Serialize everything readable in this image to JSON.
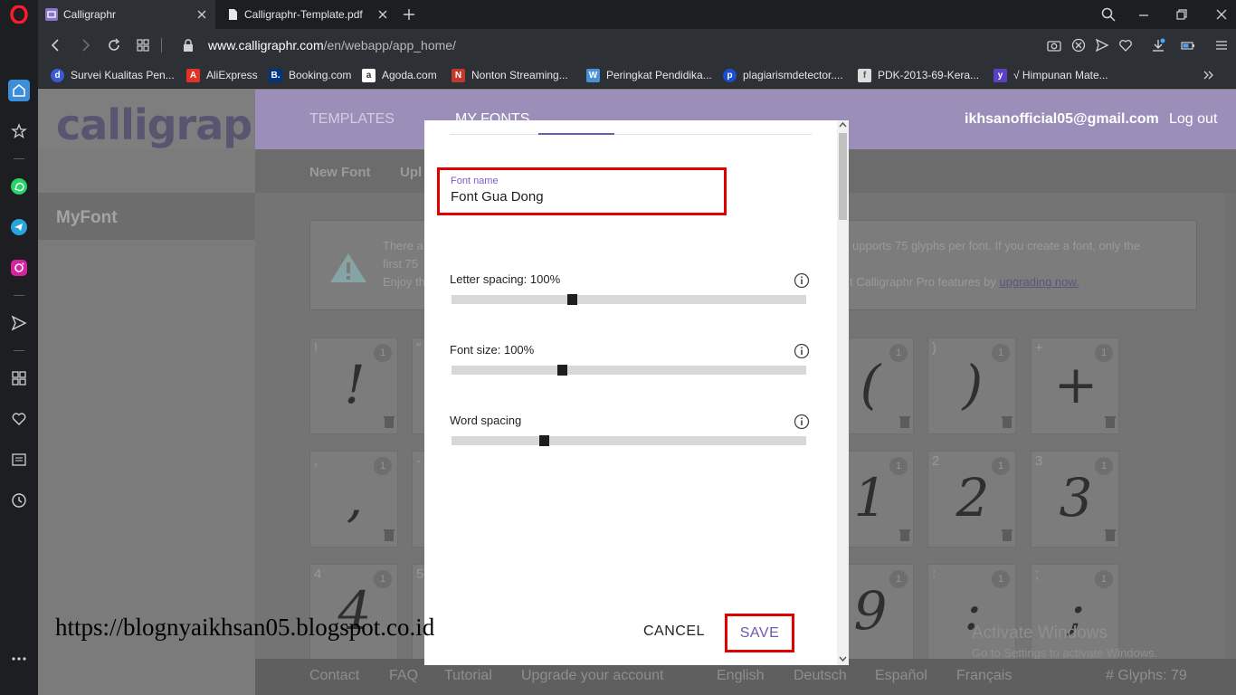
{
  "browser": {
    "tabs": [
      {
        "title": "Calligraphr",
        "active": true
      },
      {
        "title": "Calligraphr-Template.pdf",
        "active": false
      }
    ],
    "address": {
      "domain": "www.calligraphr.com",
      "path": "/en/webapp/app_home/"
    },
    "bookmarks": [
      {
        "label": "Survei Kualitas Pen...",
        "icon": "d",
        "color": "#3b5bd6"
      },
      {
        "label": "AliExpress",
        "icon": "A",
        "color": "#e43225"
      },
      {
        "label": "Booking.com",
        "icon": "B.",
        "color": "#003580"
      },
      {
        "label": "Agoda.com",
        "icon": "a",
        "color": "#ffffff"
      },
      {
        "label": "Nonton Streaming...",
        "icon": "N",
        "color": "#c0392b"
      },
      {
        "label": "Peringkat Pendidika...",
        "icon": "W",
        "color": "#4a90d9"
      },
      {
        "label": "plagiarismdetector....",
        "icon": "p",
        "color": "#1a4fd1"
      },
      {
        "label": "PDK-2013-69-Kera...",
        "icon": "f",
        "color": "#dddddd"
      },
      {
        "label": "√ Himpunan Mate...",
        "icon": "y",
        "color": "#5b3fc4"
      }
    ]
  },
  "app": {
    "logo": "calligraphr",
    "nav": {
      "templates": "TEMPLATES",
      "my_fonts": "MY FONTS",
      "email": "ikhsanofficial05@gmail.com",
      "logout": "Log out"
    },
    "subnav": {
      "new_font": "New Font",
      "upload": "Upl"
    },
    "left_nav": {
      "myfont": "MyFont"
    },
    "notice": {
      "line1_left": "There a",
      "line1_right": "upports 75 glyphs per font. If you create a font, only the",
      "line2_left": "first 75",
      "line3_left": "Enjoy th",
      "line3_right": "t Calligraphr Pro features by",
      "link": "upgrading now."
    },
    "glyph_cards": [
      {
        "char": "!",
        "count": "1",
        "glyph": "!"
      },
      {
        "char": "\"",
        "count": "1",
        "glyph": ""
      },
      {
        "char": "",
        "count": "1",
        "glyph": "("
      },
      {
        "char": ")",
        "count": "1",
        "glyph": ")"
      },
      {
        "char": "+",
        "count": "1",
        "glyph": "+"
      },
      {
        "char": ",",
        "count": "1",
        "glyph": ","
      },
      {
        "char": "-",
        "count": "1",
        "glyph": ""
      },
      {
        "char": "",
        "count": "1",
        "glyph": "1"
      },
      {
        "char": "2",
        "count": "1",
        "glyph": "2"
      },
      {
        "char": "3",
        "count": "1",
        "glyph": "3"
      },
      {
        "char": "4",
        "count": "1",
        "glyph": "4"
      },
      {
        "char": "5",
        "count": "1",
        "glyph": ""
      },
      {
        "char": "",
        "count": "1",
        "glyph": "9"
      },
      {
        "char": ":",
        "count": "1",
        "glyph": ":"
      },
      {
        "char": ";",
        "count": "1",
        "glyph": ";"
      }
    ],
    "footer": {
      "contact": "Contact",
      "faq": "FAQ",
      "tutorial": "Tutorial",
      "upgrade": "Upgrade your account",
      "english": "English",
      "deutsch": "Deutsch",
      "espanol": "Español",
      "francais": "Français",
      "glyphs": "# Glyphs: 79"
    },
    "activate": {
      "title": "Activate Windows",
      "subtitle": "Go to Settings to activate Windows."
    }
  },
  "modal": {
    "font_name_label": "Font name",
    "font_name_value": "Font Gua Dong",
    "letter_spacing_label": "Letter spacing: 100%",
    "letter_spacing_value": 0.34,
    "font_size_label": "Font size: 100%",
    "font_size_value": 0.31,
    "word_spacing_label": "Word spacing",
    "word_spacing_value": 0.26,
    "cancel": "CANCEL",
    "save": "SAVE",
    "highlight_color": "#e00000",
    "accent_color": "#6f58b6"
  },
  "watermark": "https://blognyaikhsan05.blogspot.co.id"
}
